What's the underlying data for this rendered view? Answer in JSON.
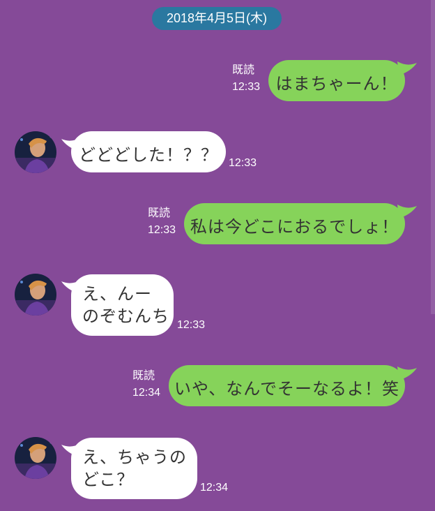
{
  "date_separator": "2018年4月5日(木)",
  "colors": {
    "background": "#854a98",
    "outgoing_bubble": "#86d35a",
    "incoming_bubble": "#ffffff",
    "date_pill": "#2a78a0",
    "meta_text": "#ffffff"
  },
  "messages": [
    {
      "direction": "outgoing",
      "text": "はまちゃーん！",
      "read_label": "既読",
      "time": "12:33"
    },
    {
      "direction": "incoming",
      "text": "どどどした！？？",
      "time": "12:33",
      "avatar": "contact-avatar"
    },
    {
      "direction": "outgoing",
      "text": "私は今どこにおるでしょ！",
      "read_label": "既読",
      "time": "12:33"
    },
    {
      "direction": "incoming",
      "text": "え、んー\nのぞむんち",
      "time": "12:33",
      "avatar": "contact-avatar"
    },
    {
      "direction": "outgoing",
      "text": "いや、なんでそーなるよ！笑",
      "read_label": "既読",
      "time": "12:34"
    },
    {
      "direction": "incoming",
      "text": "え、ちゃうの\nどこ？",
      "time": "12:34",
      "avatar": "contact-avatar"
    }
  ]
}
